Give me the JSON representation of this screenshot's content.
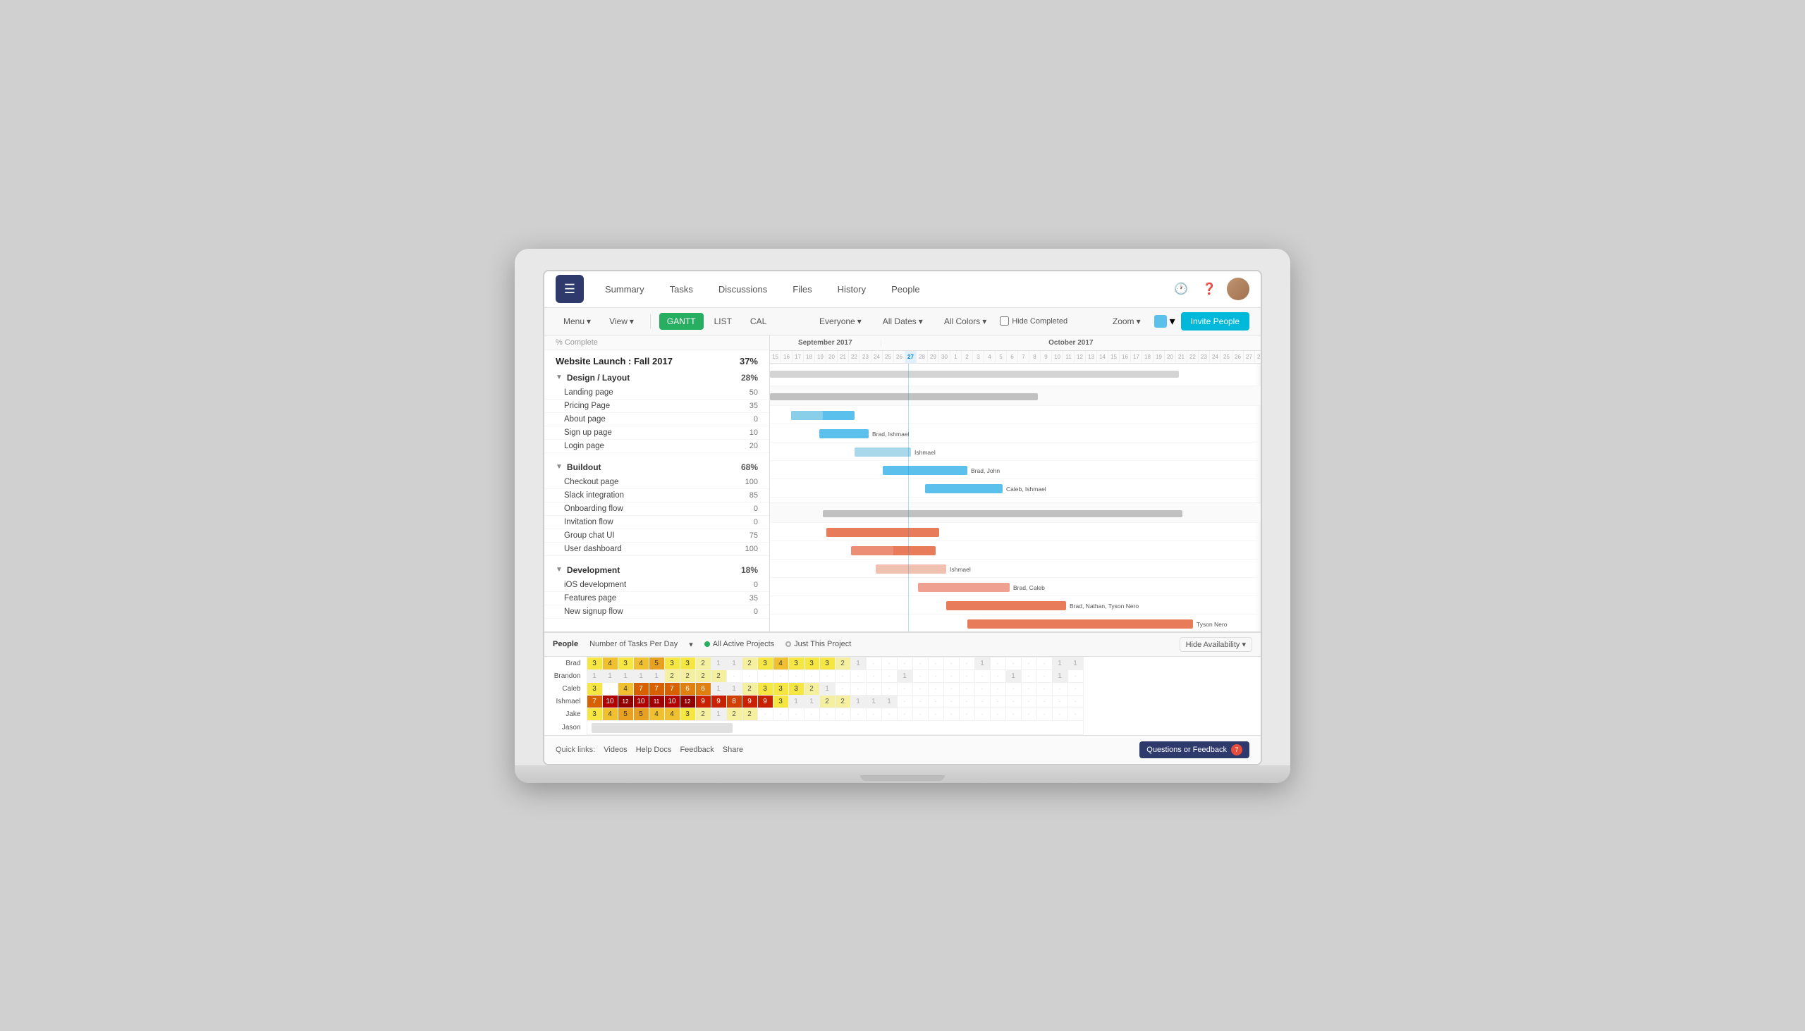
{
  "app": {
    "logo_icon": "☰",
    "nav": [
      "Summary",
      "Tasks",
      "Discussions",
      "Files",
      "History",
      "People"
    ]
  },
  "toolbar": {
    "menu_label": "Menu",
    "view_label": "View",
    "gantt_label": "GANTT",
    "list_label": "LIST",
    "cal_label": "CAL",
    "filter_everyone": "Everyone",
    "filter_dates": "All Dates",
    "filter_colors": "All Colors",
    "hide_completed": "Hide Completed",
    "zoom_label": "Zoom",
    "invite_label": "Invite People"
  },
  "project": {
    "title": "Website Launch : Fall 2017",
    "percent": "37%",
    "groups": [
      {
        "name": "Design / Layout",
        "percent": "28%",
        "tasks": [
          {
            "name": "Landing page",
            "percent": 50
          },
          {
            "name": "Pricing Page",
            "percent": 35
          },
          {
            "name": "About page",
            "percent": 0
          },
          {
            "name": "Sign up page",
            "percent": 10
          },
          {
            "name": "Login page",
            "percent": 20
          }
        ]
      },
      {
        "name": "Buildout",
        "percent": "68%",
        "tasks": [
          {
            "name": "Checkout page",
            "percent": 100
          },
          {
            "name": "Slack integration",
            "percent": 85
          },
          {
            "name": "Onboarding flow",
            "percent": 0
          },
          {
            "name": "Invitation flow",
            "percent": 0
          },
          {
            "name": "Group chat UI",
            "percent": 75
          },
          {
            "name": "User dashboard",
            "percent": 100
          }
        ]
      },
      {
        "name": "Development",
        "percent": "18%",
        "tasks": [
          {
            "name": "iOS development",
            "percent": 0
          },
          {
            "name": "Features page",
            "percent": 35
          },
          {
            "name": "New signup flow",
            "percent": 0
          }
        ]
      }
    ]
  },
  "people_section": {
    "label": "People",
    "tasks_per_day": "Number of Tasks Per Day",
    "option_all": "All Active Projects",
    "option_this": "Just This Project",
    "hide_avail": "Hide Availability",
    "people": [
      {
        "name": "Brad"
      },
      {
        "name": "Brandon"
      },
      {
        "name": "Caleb"
      },
      {
        "name": "Ishmael"
      },
      {
        "name": "Jake"
      },
      {
        "name": "Jason"
      }
    ]
  },
  "footer": {
    "quick_links": "Quick links:",
    "links": [
      "Videos",
      "Help Docs",
      "Feedback",
      "Share"
    ],
    "feedback_btn": "Questions or Feedback",
    "feedback_count": "7"
  }
}
